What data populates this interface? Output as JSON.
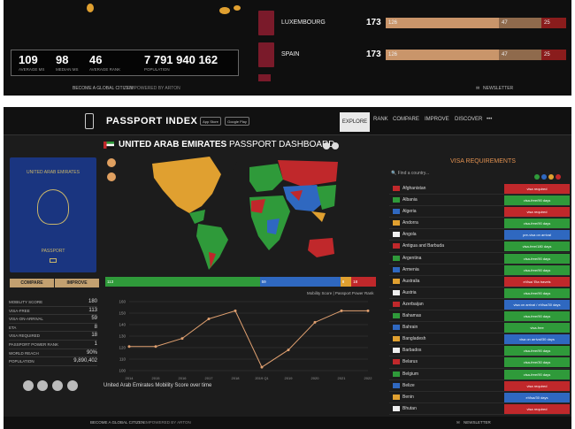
{
  "top": {
    "stats": [
      {
        "value": "109",
        "label": "AVERAGE MS"
      },
      {
        "value": "98",
        "label": "MEDIAN MS"
      },
      {
        "value": "46",
        "label": "AVERAGE RANK"
      },
      {
        "value": "7 791 940 162",
        "label": "POPULATION"
      }
    ],
    "rankings": [
      {
        "country": "LUXEMBOURG",
        "rank": "173",
        "seg1": "126",
        "seg2": "47",
        "seg3": "25"
      },
      {
        "country": "SPAIN",
        "rank": "173",
        "seg1": "126",
        "seg2": "47",
        "seg3": "25"
      }
    ],
    "footer_left": "BECOME A GLOBAL CITIZEN",
    "footer_empowered": "EMPOWERED BY ARTON",
    "footer_right": "NEWSLETTER"
  },
  "nav": {
    "brand": "PASSPORT INDEX",
    "app_store": "App Store",
    "google_play": "Google Play",
    "items": [
      "EXPLORE",
      "RANK",
      "COMPARE",
      "IMPROVE",
      "DISCOVER",
      "•••"
    ]
  },
  "passport": {
    "title1": "UNITED ARAB EMIRATES",
    "title2": "",
    "word": "PASSPORT",
    "compare": "COMPARE",
    "improve": "IMPROVE"
  },
  "stats": [
    {
      "k": "MOBILITY SCORE",
      "v": "180"
    },
    {
      "k": "VISA-FREE",
      "v": "113"
    },
    {
      "k": "VISA-ON-ARRIVAL",
      "v": "59"
    },
    {
      "k": "ETA",
      "v": "8"
    },
    {
      "k": "VISA REQUIRED",
      "v": "18"
    },
    {
      "k": "PASSPORT POWER RANK",
      "v": "1"
    },
    {
      "k": "WORLD REACH",
      "v": "90%"
    },
    {
      "k": "POPULATION",
      "v": "9,890,402"
    }
  ],
  "dashboard": {
    "title_bold": "UNITED ARAB EMIRATES",
    "title_rest": " PASSPORT DASHBOARD",
    "mobility_label": "Mobility Score | Passport Power Rank",
    "bar": [
      {
        "label": "113",
        "value": 113,
        "color": "#2f9a3a"
      },
      {
        "label": "59",
        "value": 59,
        "color": "#2f68c0"
      },
      {
        "label": "8",
        "value": 8,
        "color": "#e0a030"
      },
      {
        "label": "18",
        "value": 18,
        "color": "#c0282b"
      }
    ],
    "caption": "United Arab Emirates Mobility Score over time"
  },
  "chart_data": {
    "type": "line",
    "x": [
      "2014",
      "2015",
      "2016",
      "2017",
      "2018",
      "2019 Q1",
      "2019",
      "2020",
      "2021",
      "2022"
    ],
    "values": [
      121,
      121,
      128,
      145,
      152,
      103,
      118,
      142,
      152,
      152
    ],
    "ylim": [
      100,
      160
    ],
    "yticks": [
      100,
      110,
      120,
      130,
      140,
      150,
      160
    ],
    "grid": true,
    "line_color": "#e0a070"
  },
  "visa": {
    "title": "VISA REQUIREMENTS",
    "search_placeholder": "Find a country...",
    "rows": [
      {
        "country": "Afghanistan",
        "req": "visa required",
        "color": "#c0282b"
      },
      {
        "country": "Albania",
        "req": "visa-free/90 days",
        "color": "#2f9a3a"
      },
      {
        "country": "Algeria",
        "req": "visa required",
        "color": "#c0282b"
      },
      {
        "country": "Andorra",
        "req": "visa-free/90 days",
        "color": "#2f9a3a"
      },
      {
        "country": "Angola",
        "req": "pre-visa on arrival",
        "color": "#2f68c0"
      },
      {
        "country": "Antigua and Barbuda",
        "req": "visa-free/180 days",
        "color": "#2f9a3a"
      },
      {
        "country": "Argentina",
        "req": "visa-free/90 days",
        "color": "#2f9a3a"
      },
      {
        "country": "Armenia",
        "req": "visa-free/90 days",
        "color": "#2f9a3a"
      },
      {
        "country": "Australia",
        "req": "eVisa/ Eta travels",
        "color": "#c0282b"
      },
      {
        "country": "Austria",
        "req": "visa-free/90 days",
        "color": "#2f9a3a"
      },
      {
        "country": "Azerbaijan",
        "req": "visa on arrival / eVisa/30 days",
        "color": "#2f68c0"
      },
      {
        "country": "Bahamas",
        "req": "visa-free/90 days",
        "color": "#2f9a3a"
      },
      {
        "country": "Bahrain",
        "req": "visa-free",
        "color": "#2f9a3a"
      },
      {
        "country": "Bangladesh",
        "req": "visa on arrival/30 days",
        "color": "#2f68c0"
      },
      {
        "country": "Barbados",
        "req": "visa-free/90 days",
        "color": "#2f9a3a"
      },
      {
        "country": "Belarus",
        "req": "visa-free/30 days",
        "color": "#2f9a3a"
      },
      {
        "country": "Belgium",
        "req": "visa-free/90 days",
        "color": "#2f9a3a"
      },
      {
        "country": "Belize",
        "req": "visa required",
        "color": "#c0282b"
      },
      {
        "country": "Benin",
        "req": "eVisa/30 days",
        "color": "#2f68c0"
      },
      {
        "country": "Bhutan",
        "req": "visa required",
        "color": "#c0282b"
      }
    ]
  },
  "footer": {
    "left": "BECOME A GLOBAL CITIZEN",
    "empowered": "EMPOWERED BY ARTON",
    "right": "NEWSLETTER"
  }
}
